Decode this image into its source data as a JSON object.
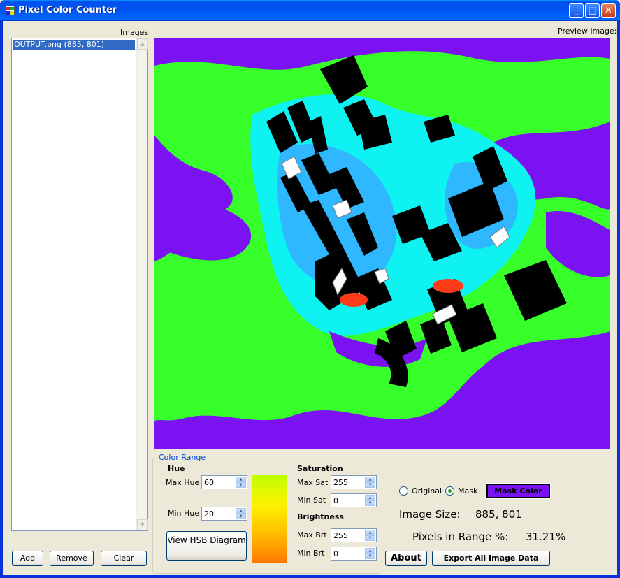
{
  "window": {
    "title": "Pixel Color Counter",
    "controls": {
      "minimize": "_",
      "maximize": "□",
      "close": "✕"
    }
  },
  "images_panel": {
    "label": "Images",
    "items": [
      "OUTPUT.png (885, 801)"
    ],
    "buttons": {
      "add": "Add",
      "remove": "Remove",
      "clear": "Clear"
    }
  },
  "preview": {
    "label": "Preview Image:"
  },
  "color_range": {
    "title": "Color Range",
    "hue": {
      "heading": "Hue",
      "max_label": "Max Hue",
      "max_value": "60",
      "min_label": "Min Hue",
      "min_value": "20"
    },
    "view_hsb_button": "View HSB Diagram",
    "saturation": {
      "heading": "Saturation",
      "max_label": "Max Sat",
      "max_value": "255",
      "min_label": "Min Sat",
      "min_value": "0"
    },
    "brightness": {
      "heading": "Brightness",
      "max_label": "Max Brt",
      "max_value": "255",
      "min_label": "Min Brt",
      "min_value": "0"
    }
  },
  "view_mode": {
    "original_label": "Original",
    "mask_label": "Mask",
    "selected": "Mask",
    "mask_color_button": "Mask Color",
    "mask_color": "#7a12f2"
  },
  "stats": {
    "image_size_label": "Image Size:",
    "image_size_value": "885, 801",
    "pixels_in_range_label": "Pixels in Range %:",
    "pixels_in_range_value": "31.21%"
  },
  "bottom_buttons": {
    "about": "About",
    "export": "Export All Image Data"
  }
}
